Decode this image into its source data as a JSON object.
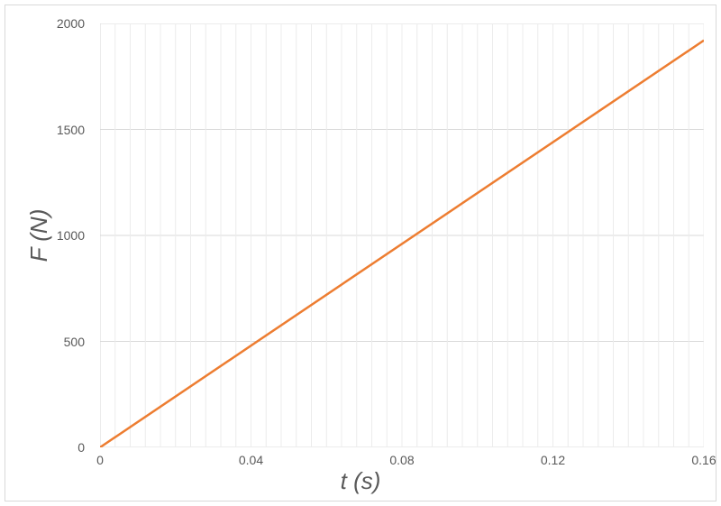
{
  "chart_data": {
    "type": "line",
    "x": [
      0,
      0.04,
      0.08,
      0.12,
      0.16
    ],
    "y": [
      0,
      480,
      960,
      1440,
      1920
    ],
    "xlabel": "t (s)",
    "ylabel": "F (N)",
    "xlim": [
      0,
      0.16
    ],
    "ylim": [
      0,
      2000
    ],
    "xticks": [
      0,
      0.04,
      0.08,
      0.12,
      0.16
    ],
    "yticks": [
      0,
      500,
      1000,
      1500,
      2000
    ],
    "series_color": "#ed7d31",
    "grid_color": "#d9d9d9",
    "tick_color": "#595959"
  },
  "axis": {
    "x_label": "t (s)",
    "y_label": "F (N)"
  },
  "ticks": {
    "y0": "0",
    "y1": "500",
    "y2": "1000",
    "y3": "1500",
    "y4": "2000",
    "x0": "0",
    "x1": "0.04",
    "x2": "0.08",
    "x3": "0.12",
    "x4": "0.16"
  }
}
